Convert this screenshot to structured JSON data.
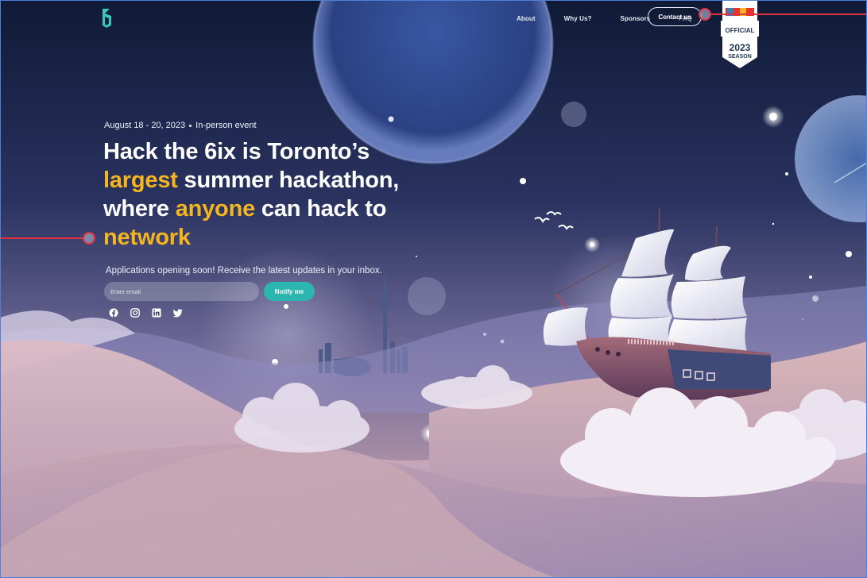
{
  "brand": {
    "logo_icon": "hack-the-6ix-logo-icon"
  },
  "nav": {
    "items": [
      {
        "label": "About"
      },
      {
        "label": "Why Us?"
      },
      {
        "label": "Sponsors"
      },
      {
        "label": "FAQ"
      }
    ],
    "contact_label": "Contact us"
  },
  "badge": {
    "line1": "OFFICIAL",
    "line2": "2023",
    "line3": "SEASON",
    "logo_text": "mlh"
  },
  "hero": {
    "date": "August 18 - 20, 2023",
    "event_type": "In-person event",
    "title_part1": "Hack the 6ix is Toronto’s",
    "title_hl1": "largest",
    "title_part2": " summer hackathon, where",
    "title_hl2": "anyone",
    "title_part3": " can hack to",
    "title_hl3": "network",
    "subtitle": "Applications opening soon! Receive the latest updates in your inbox.",
    "email_placeholder": "Enter email",
    "notify_label": "Notify me"
  },
  "socials": [
    "facebook-icon",
    "instagram-icon",
    "linkedin-icon",
    "twitter-icon"
  ],
  "colors": {
    "accent": "#f5b520",
    "button_teal": "#2bb6b0",
    "sky_top": "#0f1a36",
    "annotation_red": "#e0333f"
  }
}
